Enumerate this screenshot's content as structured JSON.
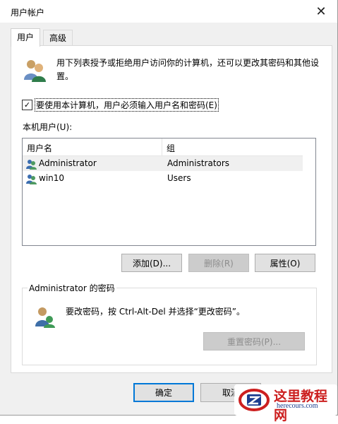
{
  "window": {
    "title": "用户帐户"
  },
  "tabs": [
    {
      "label": "用户"
    },
    {
      "label": "高级"
    }
  ],
  "users_tab": {
    "description": "用下列表授予或拒绝用户访问你的计算机，还可以更改其密码和其他设置。",
    "require_password_checkbox": {
      "label": "要使用本计算机，用户必须输入用户名和密码(E)",
      "checked": true
    },
    "local_users_label": "本机用户(U):",
    "columns": [
      "用户名",
      "组"
    ],
    "rows": [
      {
        "name": "Administrator",
        "group": "Administrators",
        "selected": true
      },
      {
        "name": "win10",
        "group": "Users",
        "selected": false
      }
    ],
    "buttons": {
      "add": "添加(D)...",
      "remove": "删除(R)",
      "properties": "属性(O)"
    },
    "password_group": {
      "title": "Administrator 的密码",
      "text": "要改密码，按 Ctrl-Alt-Del 并选择“更改密码”。",
      "reset_button": "重置密码(P)..."
    }
  },
  "footer": {
    "ok": "确定",
    "cancel": "取消"
  },
  "watermark": {
    "text": "这里教程网",
    "sub": "herecours.com"
  }
}
